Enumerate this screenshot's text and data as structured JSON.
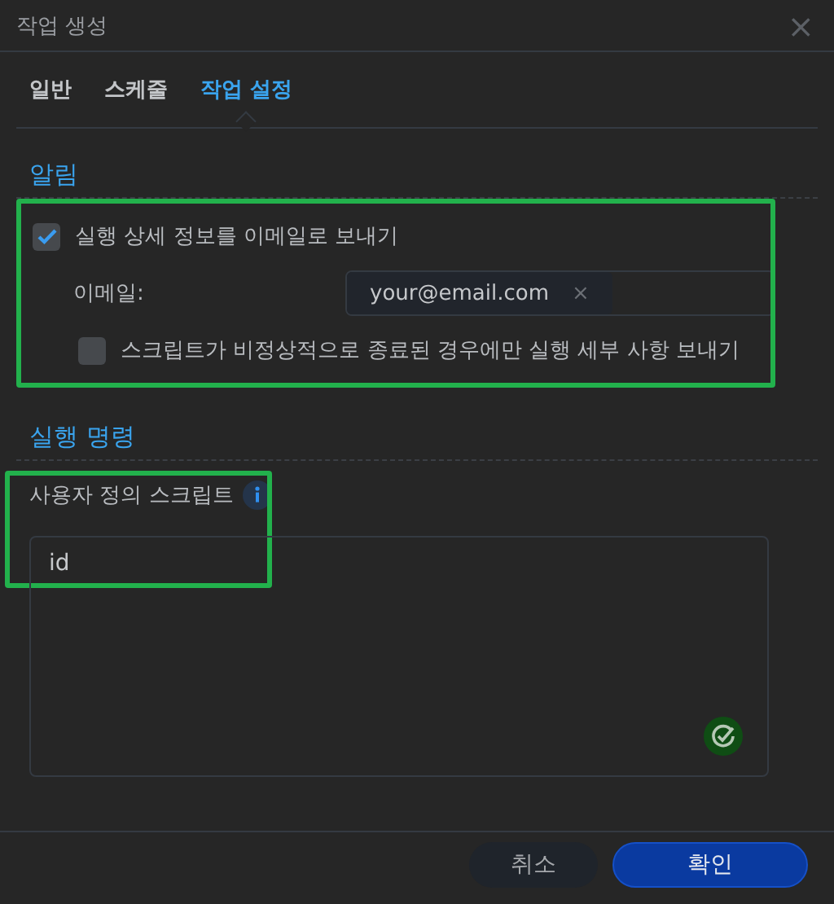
{
  "window": {
    "title": "작업 생성",
    "close": "×"
  },
  "tabs": [
    {
      "label": "일반",
      "selected": false
    },
    {
      "label": "스케줄",
      "selected": false
    },
    {
      "label": "작업 설정",
      "selected": true
    }
  ],
  "notification": {
    "heading": "알림",
    "send_details": {
      "label": "실행 상세 정보를 이메일로 보내기",
      "checked": true
    },
    "email": {
      "label": "이메일:",
      "tags": [
        {
          "value": "your@email.com",
          "remove": "×"
        }
      ]
    },
    "only_on_error": {
      "label": "스크립트가 비정상적으로 종료된 경우에만 실행 세부 사항 보내기",
      "checked": false
    }
  },
  "run_command": {
    "heading": "실행 명령",
    "script_label": "사용자 정의 스크립트",
    "script_value": "id"
  },
  "buttons": [
    {
      "label": "취소",
      "kind": "secondary"
    },
    {
      "label": "확인",
      "kind": "primary"
    }
  ]
}
